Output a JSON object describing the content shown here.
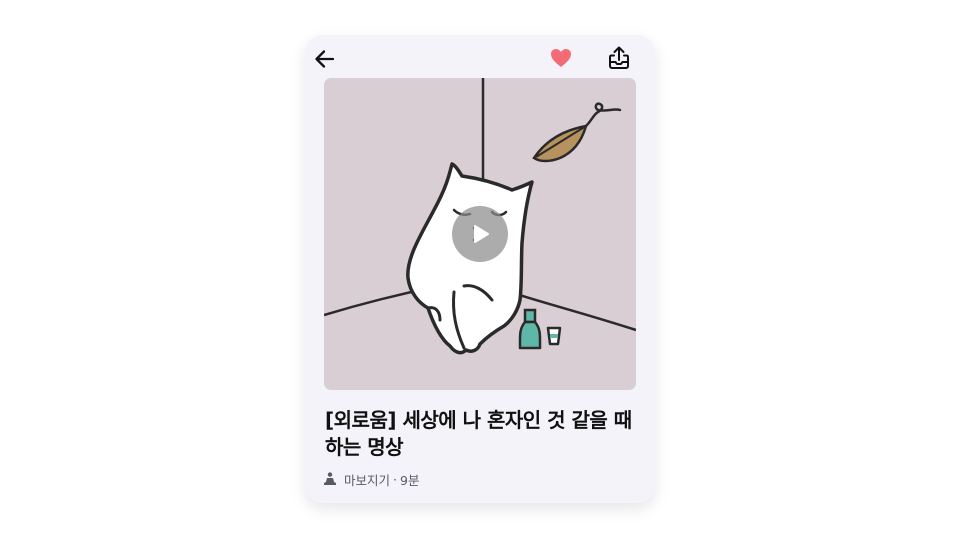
{
  "colors": {
    "card_bg": "#f4f3f9",
    "thumbnail_bg": "#d9ced3",
    "heart": "#f26b75",
    "title": "#111111",
    "meta": "#555a63"
  },
  "header": {
    "back_icon": "arrow-left-icon",
    "favorite_icon": "heart-icon",
    "favorite_active": true,
    "share_icon": "share-icon"
  },
  "thumbnail": {
    "illustration": "white cat sitting in corner with bottle and cup, falling leaf",
    "play_icon": "play-icon"
  },
  "content": {
    "title": "[외로움] 세상에 나 혼자인 것 같을 때 하는 명상",
    "category": "마보지기",
    "separator": "·",
    "duration": "9분",
    "category_icon": "meditation-person-icon"
  }
}
